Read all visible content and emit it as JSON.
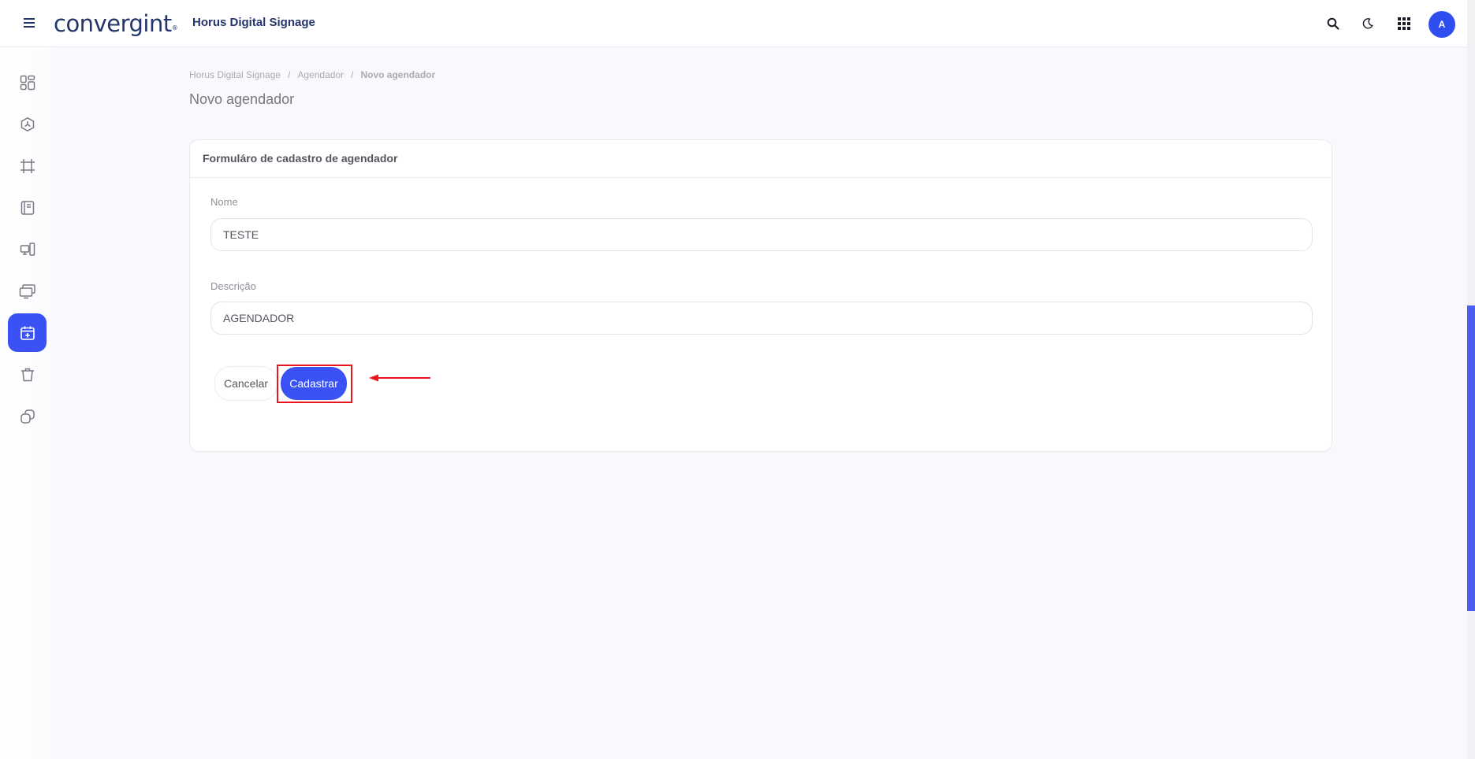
{
  "header": {
    "logo_text": "convergint",
    "logo_mark": "®",
    "app_title": "Horus Digital Signage",
    "avatar_initial": "A",
    "icons": [
      "menu-icon",
      "search-icon",
      "moon-icon",
      "grid-apps-icon"
    ]
  },
  "sidebar": {
    "items": [
      {
        "icon": "dashboard-icon"
      },
      {
        "icon": "cube-icon"
      },
      {
        "icon": "frame-icon"
      },
      {
        "icon": "book-icon"
      },
      {
        "icon": "devices-icon"
      },
      {
        "icon": "screens-icon"
      },
      {
        "icon": "calendar-add-icon",
        "active": true
      },
      {
        "icon": "trash-icon"
      },
      {
        "icon": "copy-icon"
      }
    ]
  },
  "breadcrumb": {
    "items": [
      "Horus Digital Signage",
      "Agendador",
      "Novo agendador"
    ],
    "separator": "/"
  },
  "page": {
    "title": "Novo agendador"
  },
  "form": {
    "header": "Formuláro de cadastro de agendador",
    "fields": [
      {
        "label": "Nome",
        "value": "TESTE",
        "placeholder": ""
      },
      {
        "label": "Descrição",
        "value": "AGENDADOR",
        "placeholder": ""
      }
    ],
    "cancel_label": "Cancelar",
    "submit_label": "Cadastrar"
  },
  "colors": {
    "accent": "#3a52f3",
    "brand": "#23356b",
    "annotation": "#e8161c"
  }
}
